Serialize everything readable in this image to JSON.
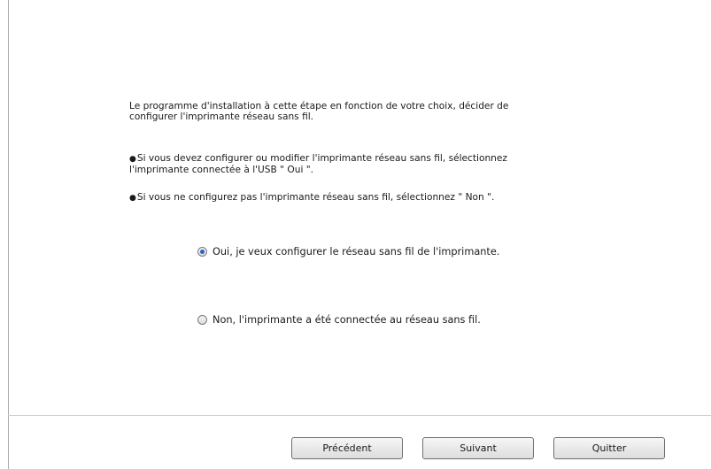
{
  "intro": {
    "line1": "Le programme d'installation à cette étape en fonction de votre choix, décider de",
    "line2": "configurer l'imprimante réseau sans fil."
  },
  "bullets": [
    {
      "symbol": "●",
      "line1": "Si vous devez configurer ou modifier l'imprimante réseau sans fil, sélectionnez",
      "line2": "l'imprimante connectée à l'USB \" Oui \"."
    },
    {
      "symbol": "●",
      "line1": "Si vous ne configurez pas l'imprimante réseau sans fil, sélectionnez \" Non \"."
    }
  ],
  "options": {
    "yes": {
      "label": "Oui, je veux configurer le réseau sans fil de l'imprimante.",
      "selected": true
    },
    "no": {
      "label": "Non, l'imprimante a été connectée au réseau sans fil.",
      "selected": false
    }
  },
  "buttons": {
    "previous": "Précédent",
    "next": "Suivant",
    "quit": "Quitter"
  },
  "colors": {
    "radio_dot": "#2a64c5"
  }
}
